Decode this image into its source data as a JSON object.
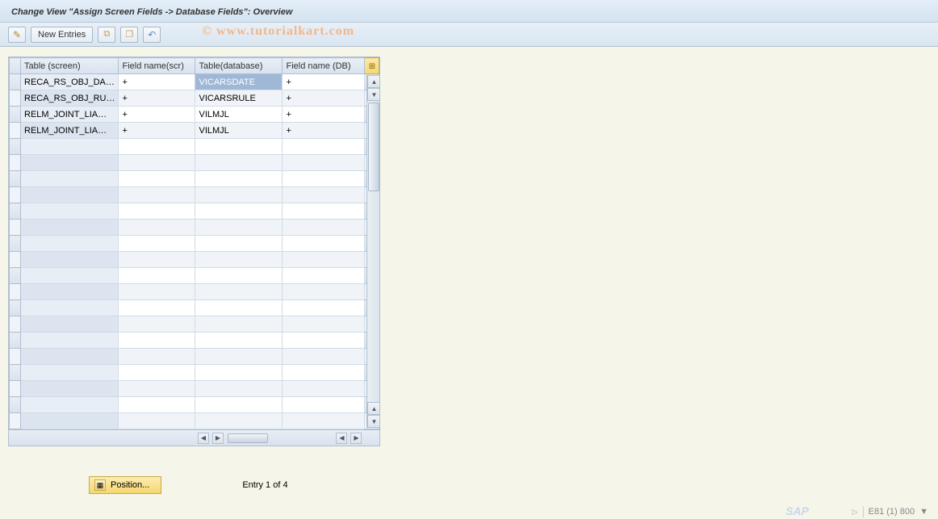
{
  "page_title": "Change View \"Assign Screen Fields -> Database Fields\": Overview",
  "watermark": "© www.tutorialkart.com",
  "toolbar": {
    "new_entries_label": "New Entries"
  },
  "columns": {
    "col0": "Table (screen)",
    "col1": "Field name(scr)",
    "col2": "Table(database)",
    "col3": "Field name (DB)"
  },
  "rows": [
    {
      "c0": "RECA_RS_OBJ_DA…",
      "c1": "+",
      "c2": "VICARSDATE",
      "c3": "+",
      "c2_selected": true
    },
    {
      "c0": "RECA_RS_OBJ_RU…",
      "c1": "+",
      "c2": "VICARSRULE",
      "c3": "+"
    },
    {
      "c0": "RELM_JOINT_LIA…",
      "c1": "+",
      "c2": "VILMJL",
      "c3": "+"
    },
    {
      "c0": "RELM_JOINT_LIA…",
      "c1": "+",
      "c2": "VILMJL",
      "c3": "+"
    }
  ],
  "empty_rows": 18,
  "footer": {
    "position_button": "Position...",
    "entry_text": "Entry 1 of 4"
  },
  "status_bar": {
    "sap_label": "SAP",
    "system": "E81 (1) 800"
  }
}
